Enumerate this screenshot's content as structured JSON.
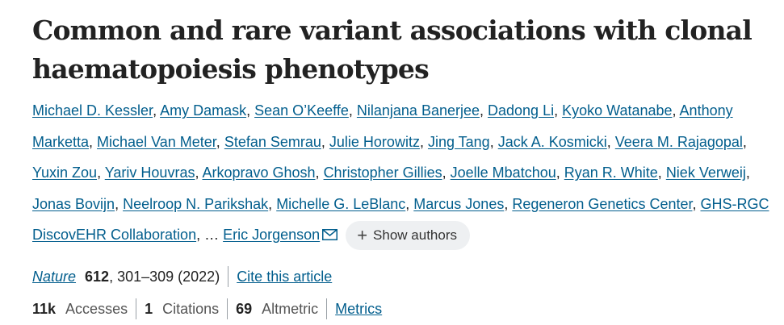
{
  "article": {
    "title": "Common and rare variant associations with clonal haematopoiesis phenotypes",
    "authors": [
      "Michael D. Kessler",
      "Amy Damask",
      "Sean O’Keeffe",
      "Nilanjana Banerjee",
      "Dadong Li",
      "Kyoko Watanabe",
      "Anthony Marketta",
      "Michael Van Meter",
      "Stefan Semrau",
      "Julie Horowitz",
      "Jing Tang",
      "Jack A. Kosmicki",
      "Veera M. Rajagopal",
      "Yuxin Zou",
      "Yariv Houvras",
      "Arkopravo Ghosh",
      "Christopher Gillies",
      "Joelle Mbatchou",
      "Ryan R. White",
      "Niek Verweij",
      "Jonas Bovijn",
      "Neelroop N. Parikshak",
      "Michelle G. LeBlanc",
      "Marcus Jones",
      "Regeneron Genetics Center",
      "GHS-RGC DiscovEHR Collaboration"
    ],
    "ellipsis": "…",
    "last_author": "Eric Jorgenson",
    "mail_icon": "envelope-icon",
    "show_authors_label": "Show authors",
    "journal": "Nature",
    "volume": "612",
    "pages_year": ", 301–309 (2022)",
    "cite_label": "Cite this article",
    "accesses_value": "11k",
    "accesses_label": "Accesses",
    "citations_value": "1",
    "citations_label": "Citations",
    "altmetric_value": "69",
    "altmetric_label": "Altmetric",
    "metrics_label": "Metrics",
    "link_color": "#025e8d"
  }
}
